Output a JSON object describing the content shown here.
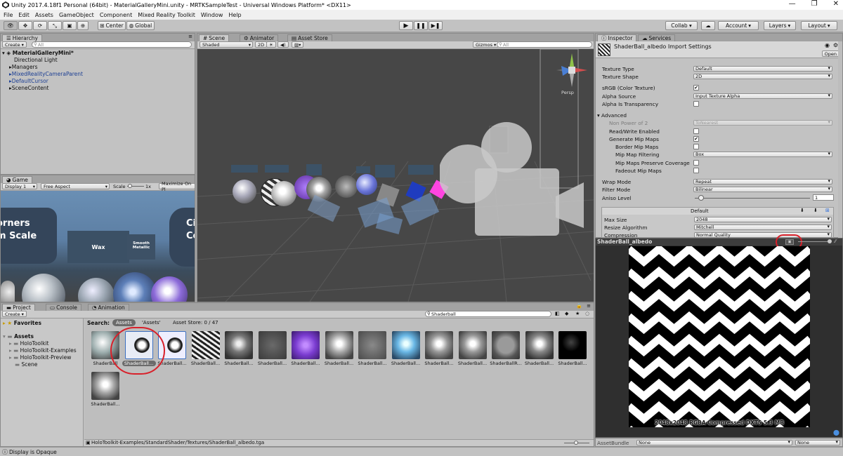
{
  "window": {
    "title": "Unity 2017.4.18f1 Personal (64bit) - MaterialGalleryMini.unity - MRTKSampleTest - Universal Windows Platform* <DX11>"
  },
  "menu": [
    "File",
    "Edit",
    "Assets",
    "GameObject",
    "Component",
    "Mixed Reality Toolkit",
    "Window",
    "Help"
  ],
  "toolbar": {
    "center_label": "Center",
    "global_label": "Global",
    "collab_label": "Collab ▾",
    "account_label": "Account",
    "layers_label": "Layers",
    "layout_label": "Layout"
  },
  "hierarchy": {
    "tab": "Hierarchy",
    "create": "Create ▾",
    "search_placeholder": "All",
    "scene": "MaterialGalleryMini*",
    "items": [
      {
        "label": "Directional Light",
        "style": "normal"
      },
      {
        "label": "Managers",
        "style": "normal"
      },
      {
        "label": "MixedRealityCameraParent",
        "style": "blue"
      },
      {
        "label": "DefaultCursor",
        "style": "blue"
      },
      {
        "label": "SceneContent",
        "style": "normal"
      }
    ]
  },
  "game": {
    "tab": "Game",
    "display": "Display 1",
    "aspect": "Free Aspect",
    "scale_label": "Scale",
    "scale_value": "1x",
    "maximize": "Maximize On Pl",
    "card1": "orners\nm Scale",
    "card2": "Wax",
    "card3": "Smooth\nMetallic",
    "card4": "Ci\nCo"
  },
  "scene": {
    "tab_scene": "Scene",
    "tab_animator": "Animator",
    "tab_store": "Asset Store",
    "shading": "Shaded",
    "mode_2d": "2D",
    "gizmos": "Gizmos ▾",
    "search_placeholder": "All",
    "persp": "Persp"
  },
  "inspector": {
    "tab": "Inspector",
    "tab_services": "Services",
    "header_title": "ShaderBall_albedo Import Settings",
    "open_label": "Open",
    "texture_type_label": "Texture Type",
    "texture_type_value": "Default",
    "texture_shape_label": "Texture Shape",
    "texture_shape_value": "2D",
    "srgb_label": "sRGB (Color Texture)",
    "alpha_source_label": "Alpha Source",
    "alpha_source_value": "Input Texture Alpha",
    "alpha_transp_label": "Alpha Is Transparency",
    "advanced_label": "Advanced",
    "npot_label": "Non Power of 2",
    "npot_value": "ToNearest",
    "rw_label": "Read/Write Enabled",
    "genmip_label": "Generate Mip Maps",
    "border_mip_label": "Border Mip Maps",
    "mip_filter_label": "Mip Map Filtering",
    "mip_filter_value": "Box",
    "mip_cov_label": "Mip Maps Preserve Coverage",
    "fadeout_label": "Fadeout Mip Maps",
    "wrap_label": "Wrap Mode",
    "wrap_value": "Repeat",
    "filter_label": "Filter Mode",
    "filter_value": "Bilinear",
    "aniso_label": "Aniso Level",
    "aniso_value": "1",
    "platform_default": "Default",
    "maxsize_label": "Max Size",
    "maxsize_value": "2048",
    "resize_label": "Resize Algorithm",
    "resize_value": "Mitchell",
    "compression_label": "Compression",
    "compression_value": "Normal Quality",
    "preview_title": "ShaderBall_albedo",
    "preview_info": "2048x2048  RGBA Compressed DXT5  5.3 MB",
    "assetbundle_label": "AssetBundle",
    "assetbundle_value": "None",
    "assetbundle_variant": "None"
  },
  "project": {
    "tab": "Project",
    "tab_console": "Console",
    "tab_animation": "Animation",
    "create": "Create ▾",
    "search_value": "Shaderball",
    "search_label": "Search:",
    "scope_assets": "Assets",
    "scope_assets_q": "'Assets'",
    "store_label": "Asset Store: 0 / 47",
    "favorites": "Favorites",
    "tree": [
      {
        "label": "Assets",
        "level": 0
      },
      {
        "label": "HoloToolkit",
        "level": 1
      },
      {
        "label": "HoloToolkit-Examples",
        "level": 1
      },
      {
        "label": "HoloToolkit-Preview",
        "level": 1
      },
      {
        "label": "Scene",
        "level": 1
      }
    ],
    "assets": [
      "ShaderBall",
      "ShaderBall...",
      "ShaderBall...",
      "ShaderBall...",
      "ShaderBall...",
      "ShaderBall...",
      "ShaderBall...",
      "ShaderBall...",
      "ShaderBall...",
      "ShaderBall...",
      "ShaderBall...",
      "ShaderBall...",
      "ShaderBallR...",
      "ShaderBall...",
      "ShaderBall...",
      "ShaderBall..."
    ],
    "path": "HoloToolkit-Examples/StandardShader/Textures/ShaderBall_albedo.tga"
  },
  "status": "Display is Opaque",
  "colors": {
    "accent_red": "#d8202a",
    "selection_blue": "#3d70c0"
  }
}
